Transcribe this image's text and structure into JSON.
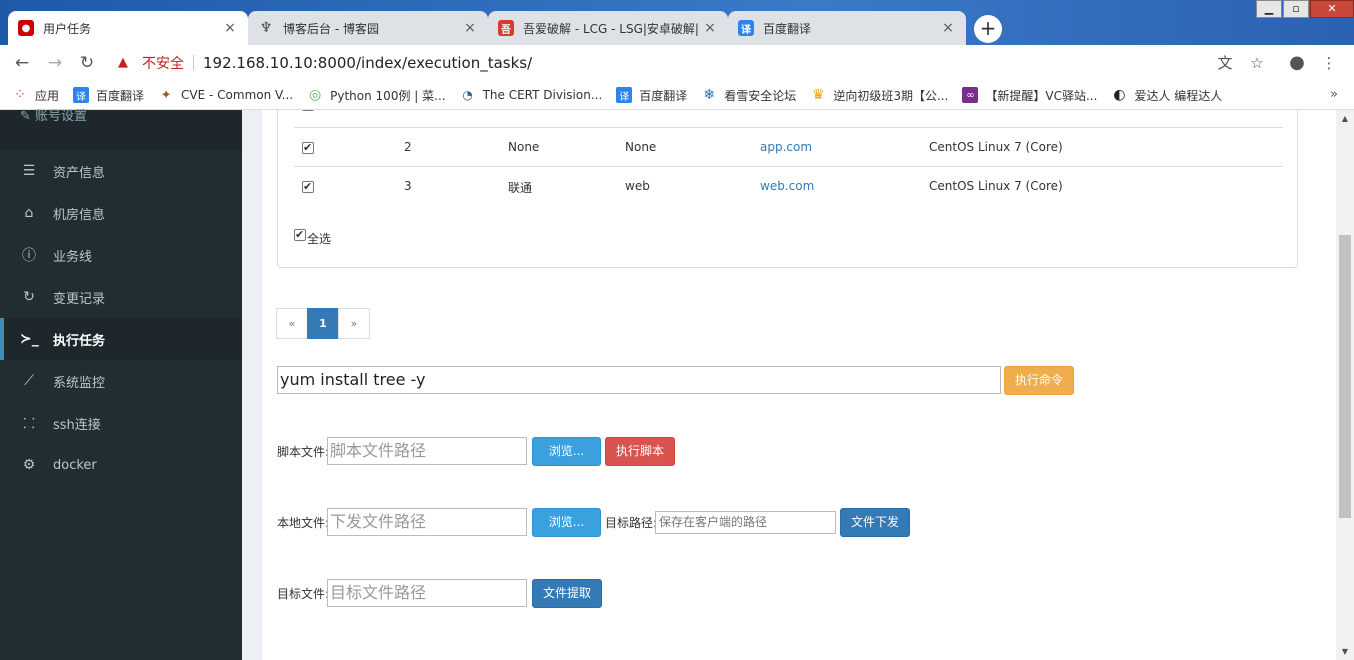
{
  "browser": {
    "tabs": [
      {
        "title": "用户任务",
        "icon": "redhat-icon",
        "color": "#c00"
      },
      {
        "title": "博客后台 - 博客园",
        "icon": "cnblogs-icon",
        "color": "#444"
      },
      {
        "title": "吾爱破解 - LCG - LSG|安卓破解|",
        "icon": "52pojie-icon",
        "color": "#d63b2f"
      },
      {
        "title": "百度翻译",
        "icon": "baidu-translate-icon",
        "color": "#2f83ee"
      }
    ],
    "new_tab_glyph": "+",
    "insecure_label": "不安全",
    "url": "192.168.10.10:8000/index/execution_tasks/",
    "bookmarks": [
      {
        "label": "应用",
        "color": "#e8453c"
      },
      {
        "label": "百度翻译",
        "color": "#2f83ee"
      },
      {
        "label": "CVE - Common V...",
        "color": "#a55a1e"
      },
      {
        "label": "Python 100例 | 菜...",
        "color": "#5cb85c"
      },
      {
        "label": "The CERT Division...",
        "color": "#2b5c8a"
      },
      {
        "label": "百度翻译",
        "color": "#2f83ee"
      },
      {
        "label": "看雪安全论坛",
        "color": "#2a6fb5"
      },
      {
        "label": "逆向初级班3期【公...",
        "color": "#e8a400"
      },
      {
        "label": "【新提醒】VC驿站...",
        "color": "#7b2d8e"
      },
      {
        "label": "爱达人 编程达人",
        "color": "#222"
      }
    ],
    "bookmarks_more": "»"
  },
  "sidebar": {
    "top_item": "账号设置",
    "items": [
      {
        "label": "资产信息",
        "icon": "server-icon",
        "glyph": "☰"
      },
      {
        "label": "机房信息",
        "icon": "home-icon",
        "glyph": "⌂"
      },
      {
        "label": "业务线",
        "icon": "info-icon",
        "glyph": "ⓘ"
      },
      {
        "label": "变更记录",
        "icon": "history-icon",
        "glyph": "↻"
      },
      {
        "label": "执行任务",
        "icon": "terminal-icon",
        "glyph": "≻_"
      },
      {
        "label": "系统监控",
        "icon": "line-chart-icon",
        "glyph": "⟋"
      },
      {
        "label": "ssh连接",
        "icon": "sitemap-icon",
        "glyph": "⸬"
      },
      {
        "label": "docker",
        "icon": "gears-icon",
        "glyph": "⚙"
      }
    ],
    "active_index": 4
  },
  "hosts_table": {
    "rows": [
      {
        "checked": true,
        "id": "2",
        "idc": "None",
        "business": "None",
        "hostname": "app.com",
        "os": "CentOS Linux 7 (Core)"
      },
      {
        "checked": true,
        "id": "3",
        "idc": "联通",
        "business": "web",
        "hostname": "web.com",
        "os": "CentOS Linux 7 (Core)"
      }
    ],
    "select_all_label": "全选"
  },
  "pagination": {
    "prev": "«",
    "current": "1",
    "next": "»"
  },
  "command": {
    "value": "yum install tree -y",
    "button": "执行命令"
  },
  "script": {
    "label": "脚本文件:",
    "placeholder": "脚本文件路径",
    "browse": "浏览...",
    "run": "执行脚本"
  },
  "upload": {
    "label": "本地文件:",
    "placeholder": "下发文件路径",
    "browse": "浏览...",
    "target_label": "目标路径:",
    "target_placeholder": "保存在客户端的路径",
    "button": "文件下发"
  },
  "download": {
    "label": "目标文件:",
    "placeholder": "目标文件路径",
    "button": "文件提取"
  }
}
